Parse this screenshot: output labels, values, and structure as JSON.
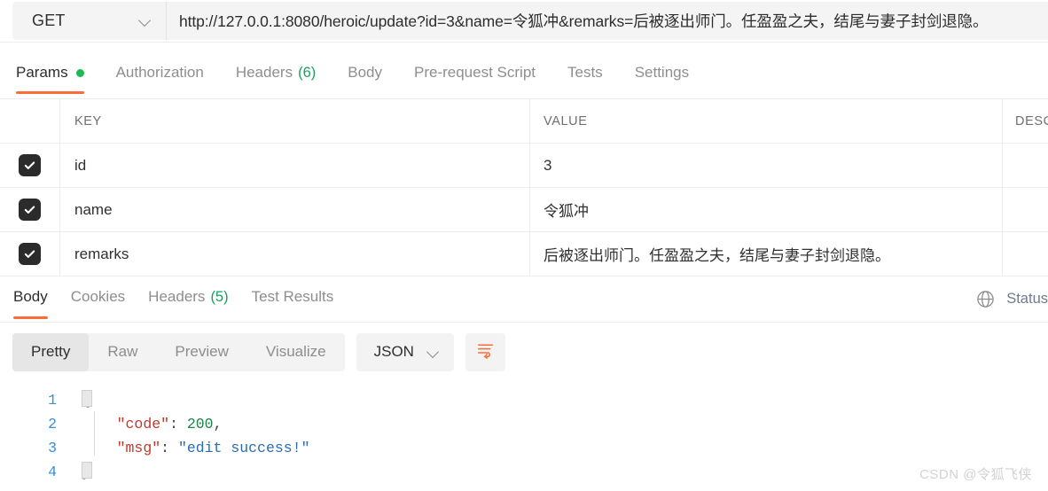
{
  "request": {
    "method": "GET",
    "method_dropdown_icon": "chevron-down-icon",
    "url": "http://127.0.0.1:8080/heroic/update?id=3&name=令狐冲&remarks=后被逐出师门。任盈盈之夫，结尾与妻子封剑退隐。"
  },
  "request_tabs": [
    {
      "label": "Params",
      "count": "",
      "badge": "dot-green",
      "active": true
    },
    {
      "label": "Authorization",
      "count": "",
      "badge": "",
      "active": false
    },
    {
      "label": "Headers",
      "count": "(6)",
      "badge": "",
      "active": false
    },
    {
      "label": "Body",
      "count": "",
      "badge": "",
      "active": false
    },
    {
      "label": "Pre-request Script",
      "count": "",
      "badge": "",
      "active": false
    },
    {
      "label": "Tests",
      "count": "",
      "badge": "",
      "active": false
    },
    {
      "label": "Settings",
      "count": "",
      "badge": "",
      "active": false
    }
  ],
  "params_table": {
    "headers": {
      "key": "KEY",
      "value": "VALUE",
      "description": "DESC"
    },
    "rows": [
      {
        "checked": true,
        "key": "id",
        "value": "3",
        "description": ""
      },
      {
        "checked": true,
        "key": "name",
        "value": "令狐冲",
        "description": ""
      },
      {
        "checked": true,
        "key": "remarks",
        "value": "后被逐出师门。任盈盈之夫，结尾与妻子封剑退隐。",
        "description": ""
      }
    ]
  },
  "response_tabs": [
    {
      "label": "Body",
      "count": "",
      "active": true
    },
    {
      "label": "Cookies",
      "count": "",
      "active": false
    },
    {
      "label": "Headers",
      "count": "(5)",
      "active": false
    },
    {
      "label": "Test Results",
      "count": "",
      "active": false
    }
  ],
  "response_status": {
    "globe_icon": "globe-icon",
    "text": "Status"
  },
  "view_toolbar": {
    "modes": [
      {
        "label": "Pretty",
        "active": true
      },
      {
        "label": "Raw",
        "active": false
      },
      {
        "label": "Preview",
        "active": false
      },
      {
        "label": "Visualize",
        "active": false
      }
    ],
    "format": "JSON",
    "format_dropdown_icon": "chevron-down-icon",
    "wrap_icon": "wrap-lines-icon"
  },
  "response_body": {
    "language": "json",
    "lines": [
      {
        "no": "1",
        "text": "{"
      },
      {
        "no": "2",
        "text": "    \"code\": 200,"
      },
      {
        "no": "3",
        "text": "    \"msg\": \"edit success!\""
      },
      {
        "no": "4",
        "text": "}"
      }
    ],
    "values": {
      "code": "200",
      "msg": "edit success!"
    }
  },
  "watermark": {
    "text": "CSDN @令狐飞侠"
  },
  "colors": {
    "accent": "#ff6c37",
    "success_dot": "#1db954",
    "count_green": "#18a05c",
    "checkbox": "#2b2b2b",
    "json_key": "#c0392b",
    "json_number": "#1e8449",
    "json_string": "#2b6cb0",
    "line_number": "#3a8fd6"
  }
}
